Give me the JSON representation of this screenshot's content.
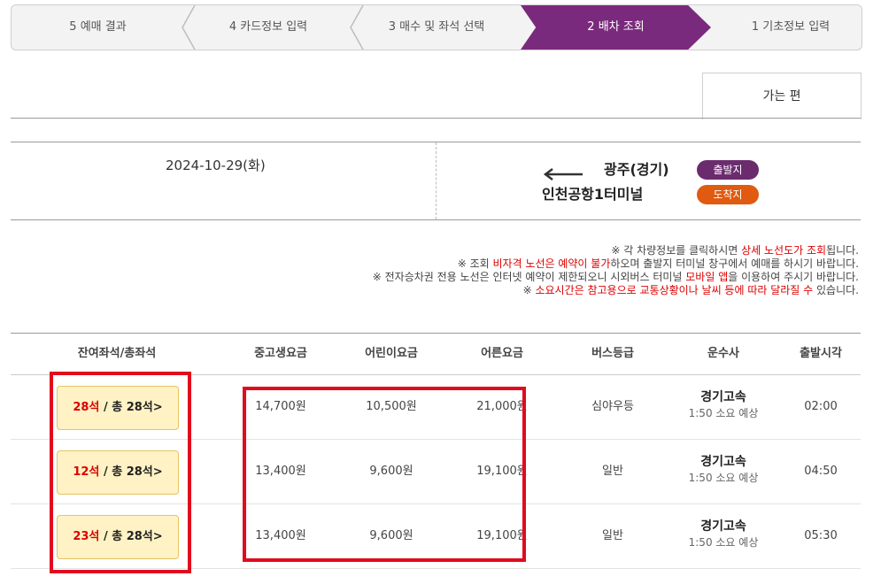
{
  "steps": [
    {
      "label": "1 기초정보 입력"
    },
    {
      "label": "2 배차 조회"
    },
    {
      "label": "3 매수 및 좌석 선택"
    },
    {
      "label": "4 카드정보 입력"
    },
    {
      "label": "5 예매 결과"
    }
  ],
  "tab": {
    "label": "가는 편"
  },
  "route": {
    "departure_badge": "출발지",
    "arrival_badge": "도착지",
    "departure": "광주(경기)",
    "arrival": "인천공항1터미널",
    "date": "2024-10-29(화)"
  },
  "notes": [
    {
      "pre": "※ 각 차량정보를 클릭하시면 ",
      "red": "상세 노선도가 조회",
      "post": "됩니다."
    },
    {
      "pre": "※ 조회 ",
      "red": "비자격 노선은 예약이 불가",
      "post": "하오며 출발지 터미널 창구에서 예매를 하시기 바랍니다."
    },
    {
      "pre": "※ 전자승차권 전용 노선은 인터넷 예약이 제한되오니 시외버스 터미널 ",
      "red": "모바일 앱",
      "post": "을 이용하여 주시기 바랍니다."
    },
    {
      "pre": "※ ",
      "red": "소요시간은 참고용으로 교통상황이나 날씨 등에 따라 달라질 수",
      "post": " 있습니다."
    }
  ],
  "table": {
    "headers": [
      "출발시각",
      "운수사",
      "버스등급",
      "어른요금",
      "어린이요금",
      "중고생요금",
      "잔여좌석/총좌석"
    ],
    "rows": [
      {
        "time": "02:00",
        "company": "경기고속",
        "duration": "1:50 소요 예상",
        "grade": "심야우등",
        "adult": "21,000원",
        "child": "10,500원",
        "teen": "14,700원",
        "seats_red": "28석",
        "seats_total": "/ 총 28석>"
      },
      {
        "time": "04:50",
        "company": "경기고속",
        "duration": "1:50 소요 예상",
        "grade": "일반",
        "adult": "19,100원",
        "child": "9,600원",
        "teen": "13,400원",
        "seats_red": "12석",
        "seats_total": "/ 총 28석>"
      },
      {
        "time": "05:30",
        "company": "경기고속",
        "duration": "1:50 소요 예상",
        "grade": "일반",
        "adult": "19,100원",
        "child": "9,600원",
        "teen": "13,400원",
        "seats_red": "23석",
        "seats_total": "/ 총 28석>"
      }
    ]
  },
  "colors": {
    "active_step": "#7a2a7c",
    "departure_badge": "#6b2c6e",
    "arrival_badge": "#e05a10",
    "highlight": "#e10b1e"
  }
}
